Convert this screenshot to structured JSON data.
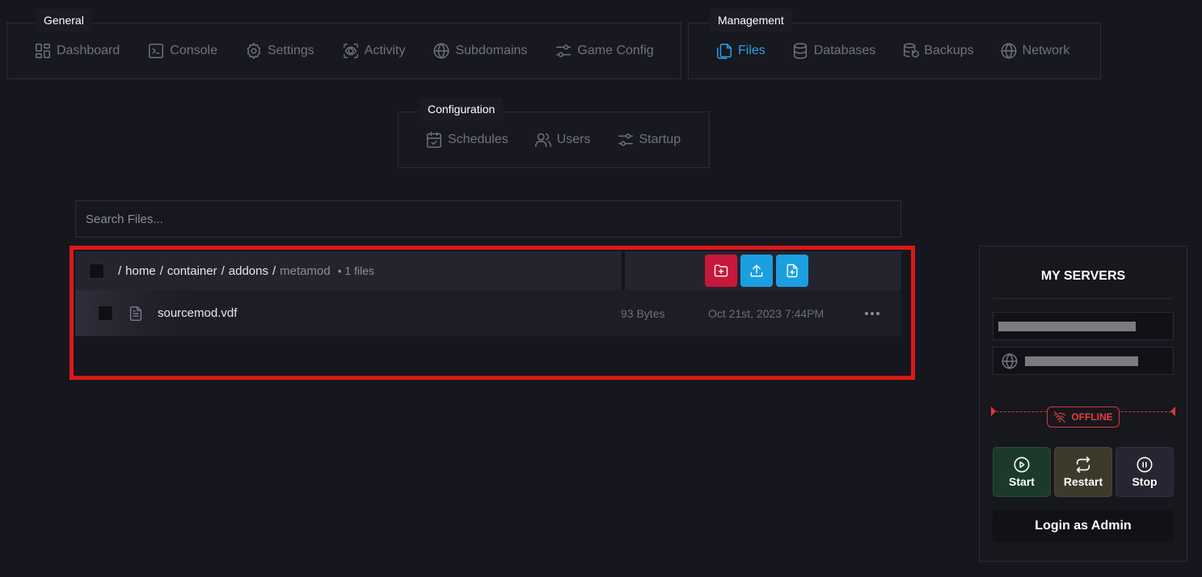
{
  "nav": {
    "general": {
      "legend": "General",
      "items": [
        {
          "label": "Dashboard",
          "icon": "dashboard-icon"
        },
        {
          "label": "Console",
          "icon": "console-icon"
        },
        {
          "label": "Settings",
          "icon": "gear-icon"
        },
        {
          "label": "Activity",
          "icon": "activity-icon"
        },
        {
          "label": "Subdomains",
          "icon": "globe-icon"
        },
        {
          "label": "Game Config",
          "icon": "sliders-icon"
        }
      ]
    },
    "management": {
      "legend": "Management",
      "items": [
        {
          "label": "Files",
          "icon": "files-icon",
          "active": true
        },
        {
          "label": "Databases",
          "icon": "database-icon"
        },
        {
          "label": "Backups",
          "icon": "backup-icon"
        },
        {
          "label": "Network",
          "icon": "globe-icon"
        }
      ]
    },
    "configuration": {
      "legend": "Configuration",
      "items": [
        {
          "label": "Schedules",
          "icon": "calendar-check-icon"
        },
        {
          "label": "Users",
          "icon": "users-icon"
        },
        {
          "label": "Startup",
          "icon": "sliders-icon"
        }
      ]
    }
  },
  "search": {
    "placeholder": "Search Files..."
  },
  "files": {
    "breadcrumb": {
      "root_sep": "/",
      "parts": [
        "home",
        "container",
        "addons"
      ],
      "current": "metamod"
    },
    "count_label": "• 1 files",
    "actions": [
      "new-folder",
      "upload",
      "new-file"
    ],
    "rows": [
      {
        "name": "sourcemod.vdf",
        "size": "93 Bytes",
        "modified": "Oct 21st, 2023 7:44PM"
      }
    ]
  },
  "sidebar": {
    "title": "MY SERVERS",
    "status": "OFFLINE",
    "buttons": {
      "start": "Start",
      "restart": "Restart",
      "stop": "Stop"
    },
    "login": "Login as Admin"
  },
  "colors": {
    "accent": "#22a6e6",
    "danger": "#c8183c",
    "highlight_frame": "#dd1818",
    "offline": "#e23e3e"
  }
}
